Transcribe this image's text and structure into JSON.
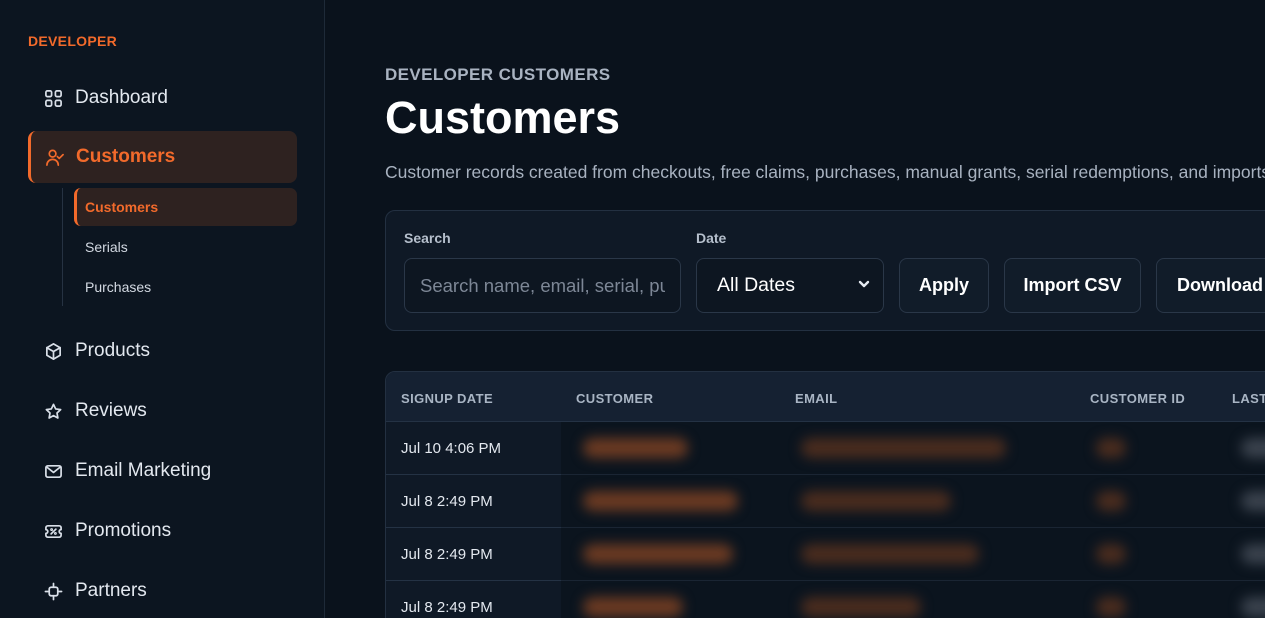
{
  "sidebar": {
    "brand": "DEVELOPER",
    "nav": [
      {
        "label": "Dashboard",
        "icon": "grid-icon"
      },
      {
        "label": "Customers",
        "icon": "user-check-icon",
        "active": true
      },
      {
        "label": "Products",
        "icon": "box-icon"
      },
      {
        "label": "Reviews",
        "icon": "star-icon"
      },
      {
        "label": "Email Marketing",
        "icon": "mail-icon"
      },
      {
        "label": "Promotions",
        "icon": "ticket-icon"
      },
      {
        "label": "Partners",
        "icon": "partners-icon"
      }
    ],
    "sub": [
      {
        "label": "Customers",
        "active": true
      },
      {
        "label": "Serials"
      },
      {
        "label": "Purchases"
      }
    ]
  },
  "header": {
    "eyebrow": "DEVELOPER CUSTOMERS",
    "title": "Customers",
    "description": "Customer records created from checkouts, free claims, purchases, manual grants, serial redemptions, and imports."
  },
  "filters": {
    "search_label": "Search",
    "search_placeholder": "Search name, email, serial, purchase",
    "date_label": "Date",
    "date_value": "All Dates",
    "apply": "Apply",
    "import": "Import CSV",
    "download": "Download CSV"
  },
  "table": {
    "columns": [
      "SIGNUP DATE",
      "CUSTOMER",
      "EMAIL",
      "CUSTOMER ID",
      "LAST PURCHASE"
    ],
    "rows": [
      {
        "signup": "Jul 10 4:06 PM"
      },
      {
        "signup": "Jul 8 2:49 PM"
      },
      {
        "signup": "Jul 8 2:49 PM"
      },
      {
        "signup": "Jul 8 2:49 PM"
      }
    ]
  },
  "colors": {
    "accent": "#f26a2b",
    "background": "#0a121c",
    "sidebar": "#0c1520"
  }
}
